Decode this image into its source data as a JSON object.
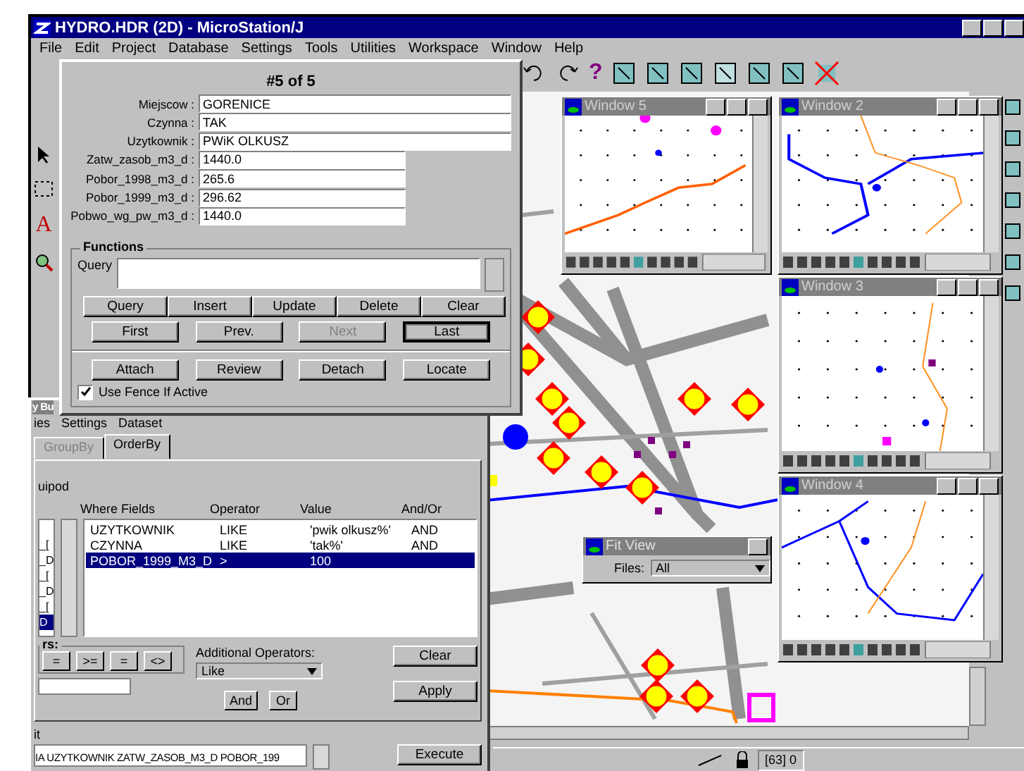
{
  "window": {
    "title": "HYDRO.HDR (2D) - MicroStation/J"
  },
  "menu": [
    "File",
    "Edit",
    "Project",
    "Database",
    "Settings",
    "Tools",
    "Utilities",
    "Workspace",
    "Window",
    "Help"
  ],
  "toolbar": {
    "help_glyph": "?"
  },
  "tool_palette": {
    "text_tool_glyph": "A"
  },
  "record_dialog": {
    "heading": "#5 of 5",
    "fields": [
      {
        "label": "Miejscow :",
        "value": "GORENICE",
        "kind": "wide"
      },
      {
        "label": "Czynna :",
        "value": "TAK",
        "kind": "wide"
      },
      {
        "label": "Uzytkownik :",
        "value": "PWiK OLKUSZ",
        "kind": "wide"
      },
      {
        "label": "Zatw_zasob_m3_d :",
        "value": "1440.0",
        "kind": "narrow"
      },
      {
        "label": "Pobor_1998_m3_d :",
        "value": "265.6",
        "kind": "narrow"
      },
      {
        "label": "Pobor_1999_m3_d :",
        "value": "296.62",
        "kind": "narrow"
      },
      {
        "label": "Pobwo_wg_pw_m3_d :",
        "value": "1440.0",
        "kind": "narrow"
      }
    ],
    "functions_title": "Functions",
    "query_label": "Query",
    "button_rows": [
      [
        {
          "label": "Query",
          "disabled": false,
          "focused": false
        },
        {
          "label": "Insert",
          "disabled": false,
          "focused": false
        },
        {
          "label": "Update",
          "disabled": false,
          "focused": false
        },
        {
          "label": "Delete",
          "disabled": false,
          "focused": false
        },
        {
          "label": "Clear",
          "disabled": false,
          "focused": false
        }
      ],
      [
        {
          "label": "First",
          "disabled": false,
          "focused": false
        },
        {
          "label": "Prev.",
          "disabled": false,
          "focused": false
        },
        {
          "label": "Next",
          "disabled": true,
          "focused": false
        },
        {
          "label": "Last",
          "disabled": false,
          "focused": true
        }
      ],
      [
        {
          "label": "Attach",
          "disabled": false,
          "focused": false
        },
        {
          "label": "Review",
          "disabled": false,
          "focused": false
        },
        {
          "label": "Detach",
          "disabled": false,
          "focused": false
        },
        {
          "label": "Locate",
          "disabled": false,
          "focused": false
        }
      ]
    ],
    "fence": {
      "label": "Use Fence If Active",
      "checked": true
    }
  },
  "query_dialog": {
    "title": "y Bu",
    "menu": [
      "ies",
      "Settings",
      "Dataset"
    ],
    "tabs": [
      {
        "label": "GroupBy",
        "selected": false,
        "disabled": true
      },
      {
        "label": "OrderBy",
        "selected": true,
        "disabled": false
      }
    ],
    "section_label": "uipod",
    "field_list": [
      {
        "label": "_[",
        "selected": false
      },
      {
        "label": "_D",
        "selected": false
      },
      {
        "label": "_[",
        "selected": false
      },
      {
        "label": "_D",
        "selected": false
      },
      {
        "label": "_[",
        "selected": false
      },
      {
        "label": "D",
        "selected": true
      }
    ],
    "columns": [
      "Where Fields",
      "Operator",
      "Value",
      "And/Or"
    ],
    "rows": [
      {
        "cells": [
          "UZYTKOWNIK",
          "LIKE",
          "'pwik olkusz%'",
          "AND"
        ],
        "selected": false
      },
      {
        "cells": [
          "CZYNNA",
          "LIKE",
          "'tak%'",
          "AND"
        ],
        "selected": false
      },
      {
        "cells": [
          "POBOR_1999_M3_D",
          ">",
          "100",
          ""
        ],
        "selected": true
      }
    ],
    "operators_label": "rs:",
    "operators": [
      "=",
      ">=",
      "=",
      "<>"
    ],
    "additional_label": "Additional Operators:",
    "additional_value": "Like",
    "clear": "Clear",
    "and": "And",
    "or": "Or",
    "apply": "Apply",
    "statement_label": "it",
    "statement": "IA UZYTKOWNIK ZATW_ZASOB_M3_D POBOR_199",
    "execute": "Execute"
  },
  "views": [
    {
      "title": "Window 5"
    },
    {
      "title": "Window 2"
    },
    {
      "title": "Window 3"
    },
    {
      "title": "Window 4"
    }
  ],
  "fit_view": {
    "title": "Fit View",
    "files_label": "Files:",
    "files_value": "All"
  },
  "status_bar": {
    "message": "[63] 0"
  }
}
